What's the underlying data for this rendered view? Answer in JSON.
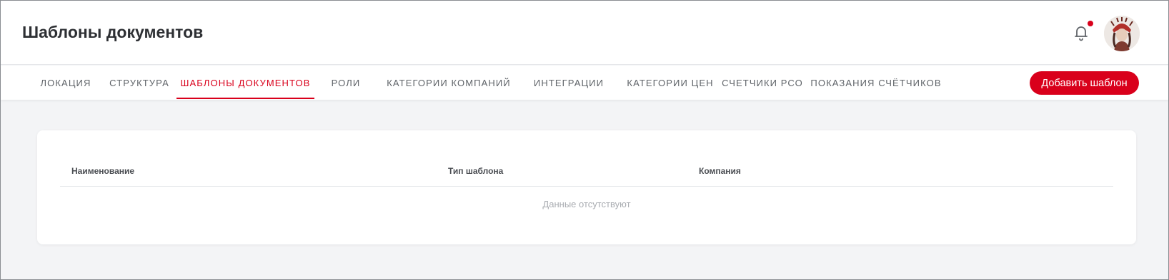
{
  "header": {
    "title": "Шаблоны документов",
    "notification_icon": "bell-icon",
    "notification_badge_color": "#d9001b",
    "avatar_icon": "user-avatar"
  },
  "tabs": [
    {
      "label": "ЛОКАЦИЯ",
      "active": false
    },
    {
      "label": "СТРУКТУРА",
      "active": false
    },
    {
      "label": "ШАБЛОНЫ ДОКУМЕНТОВ",
      "active": true
    },
    {
      "label": "РОЛИ",
      "active": false
    },
    {
      "label": "КАТЕГОРИИ КОМПАНИЙ",
      "active": false
    },
    {
      "label": "ИНТЕГРАЦИИ",
      "active": false
    },
    {
      "label": "КАТЕГОРИИ ЦЕН",
      "active": false
    },
    {
      "label": "СЧЕТЧИКИ РСО",
      "active": false
    },
    {
      "label": "ПОКАЗАНИЯ СЧЁТЧИКОВ",
      "active": false
    }
  ],
  "actions": {
    "add_template_label": "Добавить шаблон"
  },
  "table": {
    "columns": [
      "Наименование",
      "Тип шаблона",
      "Компания"
    ],
    "rows": [],
    "empty_text": "Данные отсутствуют"
  },
  "colors": {
    "accent": "#d9001b",
    "background": "#f3f4f6"
  }
}
